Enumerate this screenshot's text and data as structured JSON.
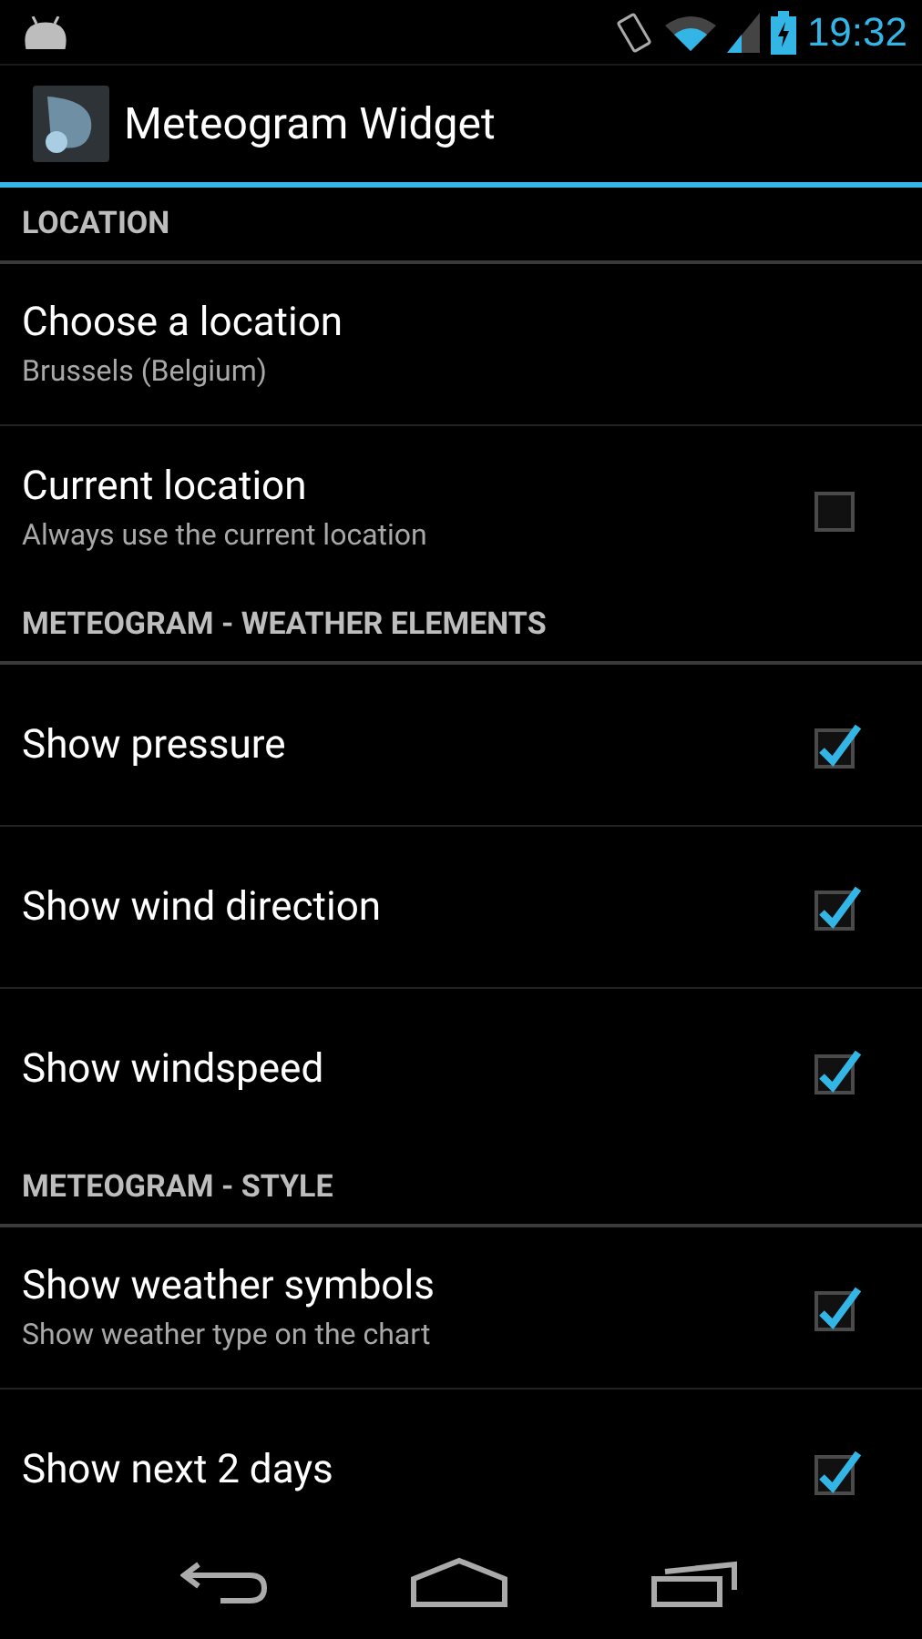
{
  "status_bar": {
    "time": "19:32"
  },
  "action_bar": {
    "title": "Meteogram Widget"
  },
  "sections": [
    {
      "header": "LOCATION",
      "items": [
        {
          "kind": "plain",
          "title": "Choose a location",
          "summary": "Brussels (Belgium)"
        },
        {
          "kind": "checkbox",
          "title": "Current location",
          "summary": "Always use the current location",
          "checked": false
        }
      ]
    },
    {
      "header": "METEOGRAM - WEATHER ELEMENTS",
      "items": [
        {
          "kind": "checkbox",
          "title": "Show pressure",
          "checked": true
        },
        {
          "kind": "checkbox",
          "title": "Show wind direction",
          "checked": true
        },
        {
          "kind": "checkbox",
          "title": "Show windspeed",
          "checked": true
        }
      ]
    },
    {
      "header": "METEOGRAM - STYLE",
      "items": [
        {
          "kind": "checkbox",
          "title": "Show weather symbols",
          "summary": "Show weather type on the chart",
          "checked": true
        },
        {
          "kind": "checkbox",
          "title": "Show next 2 days",
          "checked": true
        }
      ]
    }
  ]
}
